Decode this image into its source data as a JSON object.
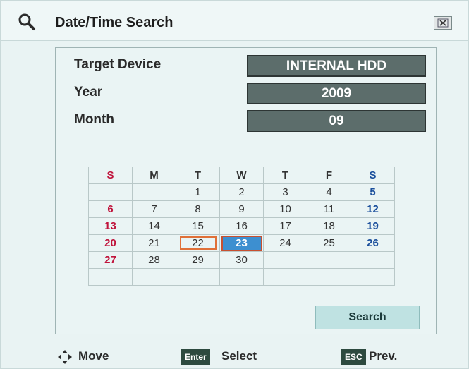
{
  "dialog": {
    "title": "Date/Time Search",
    "icons": {
      "title": "search-icon",
      "close": "close-icon",
      "move": "move-arrows-icon"
    }
  },
  "fields": [
    {
      "label": "Target Device",
      "value": "INTERNAL HDD"
    },
    {
      "label": "Year",
      "value": "2009"
    },
    {
      "label": "Month",
      "value": "09"
    }
  ],
  "calendar": {
    "weekdays": [
      "S",
      "M",
      "T",
      "W",
      "T",
      "F",
      "S"
    ],
    "weeks": [
      [
        "",
        "",
        "1",
        "2",
        "3",
        "4",
        "5"
      ],
      [
        "6",
        "7",
        "8",
        "9",
        "10",
        "11",
        "12"
      ],
      [
        "13",
        "14",
        "15",
        "16",
        "17",
        "18",
        "19"
      ],
      [
        "20",
        "21",
        "22",
        "23",
        "24",
        "25",
        "26"
      ],
      [
        "27",
        "28",
        "29",
        "30",
        "",
        "",
        ""
      ],
      [
        "",
        "",
        "",
        "",
        "",
        "",
        ""
      ]
    ],
    "highlighted_day": "22",
    "selected_day": "23",
    "colors": {
      "sunday": "#c0143c",
      "saturday": "#1b4f9c",
      "selected": "#3d8fd0",
      "highlight_border": "#e07038"
    }
  },
  "search_button": "Search",
  "footer": {
    "move": "Move",
    "enter_key": "Enter",
    "select": "Select",
    "esc_key": "ESC",
    "prev": "Prev."
  }
}
